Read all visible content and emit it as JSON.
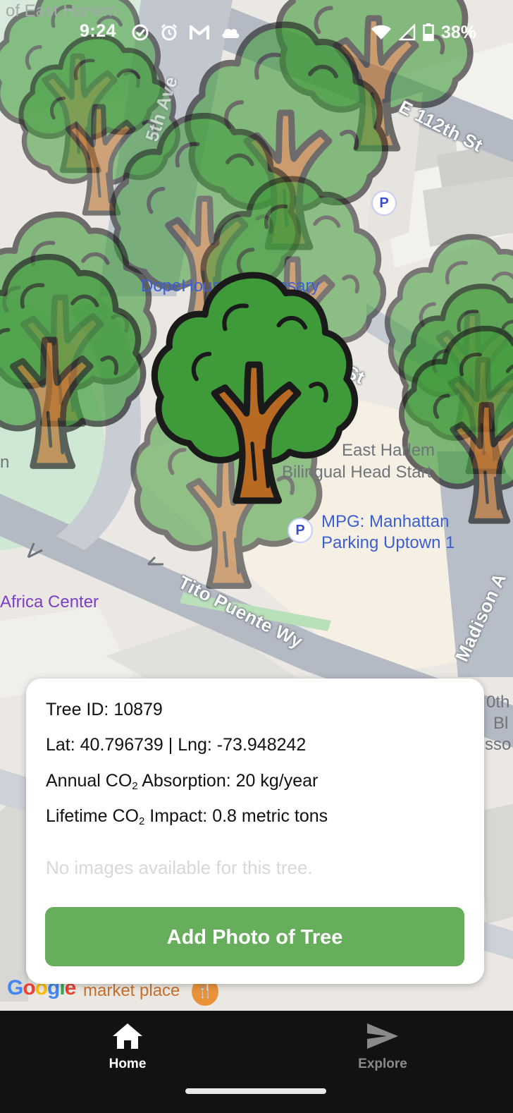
{
  "status_bar": {
    "time": "9:24",
    "battery": "38%",
    "icons": [
      "check-circle-icon",
      "alarm-icon",
      "gmail-icon",
      "cloud-icon",
      "wifi-icon",
      "signal-icon",
      "battery-icon"
    ]
  },
  "map": {
    "place_labels": {
      "east_harlem_top": "of East Harlem",
      "dispensary": "DopeHouse Dispensary",
      "head_start_1": "East Harlem",
      "head_start_2": "Bilingual Head Start",
      "mpg_1": "MPG: Manhattan",
      "mpg_2": "Parking Uptown 1",
      "africa_center": "Africa Center",
      "market_place": "market place",
      "partial_edge_1": "0th",
      "partial_edge_2": "Bl",
      "partial_edge_3": "sso",
      "partial_left": "n"
    },
    "streets": {
      "e112": "E 112th St",
      "fifth_ave": "5th Ave",
      "tito_puente": "Tito Puente Wy",
      "madison": "Madison A",
      "st_fragment": "St"
    },
    "parking_marker_label": "P",
    "google_logo": "Google",
    "colors": {
      "park": "#cfe8d3",
      "road": "#aeb5c0",
      "tree_canopy": "#3f9a3a",
      "tree_trunk": "#b86a22",
      "poi_blue": "#3b5fd0",
      "africa_purple": "#7b3fc7"
    }
  },
  "tree_info": {
    "id_line": "Tree ID: 10879",
    "coords_line": "Lat: 40.796739 | Lng: -73.948242",
    "annual_prefix": "Annual CO",
    "annual_sub": "2",
    "annual_suffix": " Absorption: 20 kg/year",
    "lifetime_prefix": "Lifetime CO",
    "lifetime_sub": "2",
    "lifetime_suffix": " Impact: 0.8 metric tons",
    "no_images": "No images available for this tree.",
    "add_photo_button": "Add Photo of Tree"
  },
  "bottom_nav": {
    "tabs": [
      {
        "label": "Home",
        "icon": "home-icon",
        "active": true
      },
      {
        "label": "Explore",
        "icon": "send-icon",
        "active": false
      }
    ],
    "colors": {
      "active": "#ffffff",
      "inactive": "#8a8a8a",
      "background": "#121212"
    }
  }
}
